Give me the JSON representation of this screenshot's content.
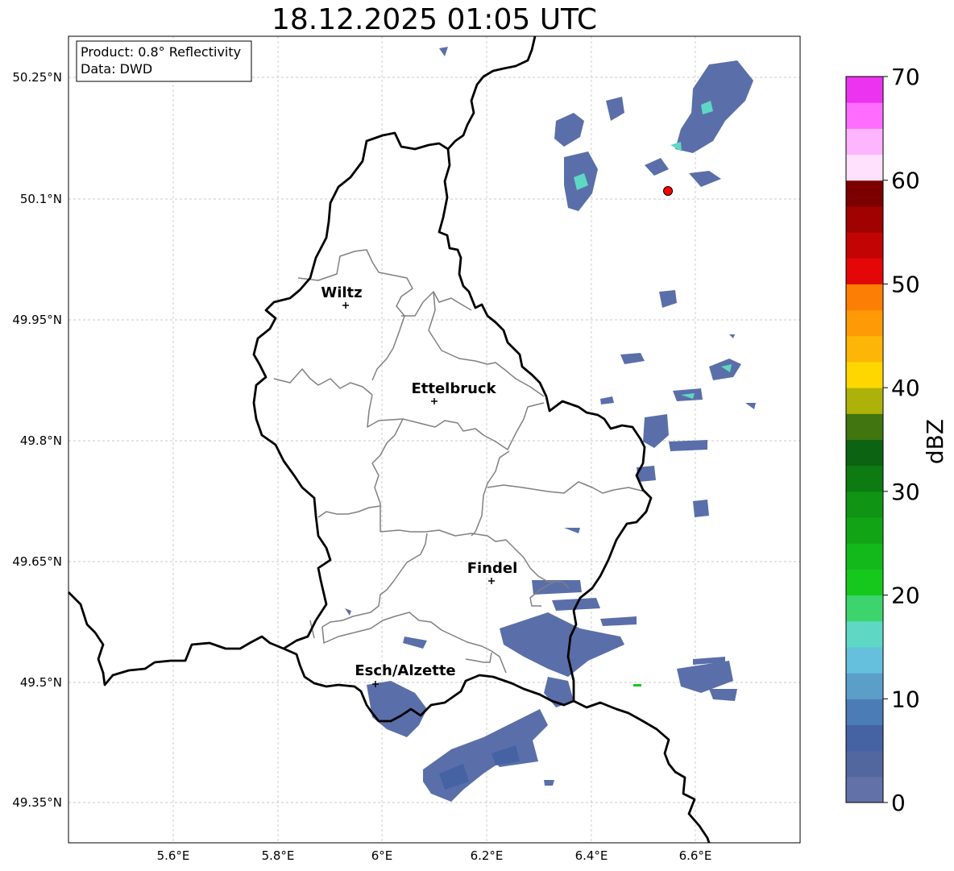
{
  "title": "18.12.2025 01:05 UTC",
  "info": {
    "product": "Product: 0.8° Reflectivity",
    "data": "Data: DWD"
  },
  "axes": {
    "lat_labels": [
      "50.25°N",
      "50.1°N",
      "49.95°N",
      "49.8°N",
      "49.65°N",
      "49.5°N",
      "49.35°N"
    ],
    "lon_labels": [
      "5.6°E",
      "5.8°E",
      "6°E",
      "6.2°E",
      "6.4°E",
      "6.6°E"
    ]
  },
  "cities": [
    {
      "name": "Wiltz"
    },
    {
      "name": "Ettelbruck"
    },
    {
      "name": "Findel"
    },
    {
      "name": "Esch/Alzette"
    }
  ],
  "colorbar": {
    "label": "dBZ",
    "ticks": [
      "0",
      "10",
      "20",
      "30",
      "40",
      "50",
      "60",
      "70"
    ],
    "colors": [
      "#6272a8",
      "#53679f",
      "#4562a3",
      "#4b7cb5",
      "#5b9fc8",
      "#64c0dd",
      "#5ed8c4",
      "#3dd46e",
      "#16c81c",
      "#13b91a",
      "#11a515",
      "#109414",
      "#0e7a12",
      "#0c6311",
      "#407510",
      "#adb20a",
      "#ffd700",
      "#fdb608",
      "#fd9a06",
      "#fd7e04",
      "#e30707",
      "#c20404",
      "#a00101",
      "#7c0000",
      "#ffe1fe",
      "#ffb4fe",
      "#ff6dfe",
      "#ec33ef"
    ]
  },
  "colors": {
    "border": "#000000",
    "canton": "#808080",
    "grid": "#b8b8b8",
    "radar_marker": "#ff0000"
  }
}
